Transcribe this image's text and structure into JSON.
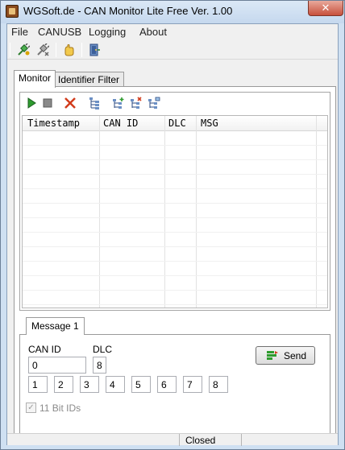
{
  "window": {
    "title": "WGSoft.de - CAN Monitor Lite Free Ver. 1.00",
    "close_glyph": "✕"
  },
  "menu": {
    "items": [
      "File",
      "CANUSB",
      "Logging",
      "About"
    ]
  },
  "toolbar": {
    "icons": [
      "connect-plug-icon",
      "disconnect-plug-icon",
      "settings-hand-icon",
      "exit-door-icon"
    ]
  },
  "tabs": {
    "items": [
      "Monitor",
      "Identifier Filter"
    ],
    "active": "Monitor"
  },
  "monitor": {
    "toolbar_icons": [
      "start-icon",
      "stop-icon",
      "clear-icon",
      "tree-icon",
      "add-filter-icon",
      "remove-filter-icon",
      "edit-filter-icon"
    ],
    "columns": [
      "Timestamp",
      "CAN ID",
      "DLC",
      "MSG"
    ]
  },
  "message": {
    "tab_label": "Message 1",
    "can_id_label": "CAN ID",
    "dlc_label": "DLC",
    "can_id_value": "0",
    "dlc_value": "8",
    "bytes": [
      "1",
      "2",
      "3",
      "4",
      "5",
      "6",
      "7",
      "8"
    ],
    "send_label": "Send",
    "eleven_bit_label": "11 Bit IDs",
    "eleven_bit_checked": true
  },
  "status": {
    "text": "Closed"
  },
  "colors": {
    "title_bar": "#c5d8ee",
    "close_button": "#c7503c",
    "start_green": "#2e9b2e",
    "clear_red": "#d23c1c"
  }
}
